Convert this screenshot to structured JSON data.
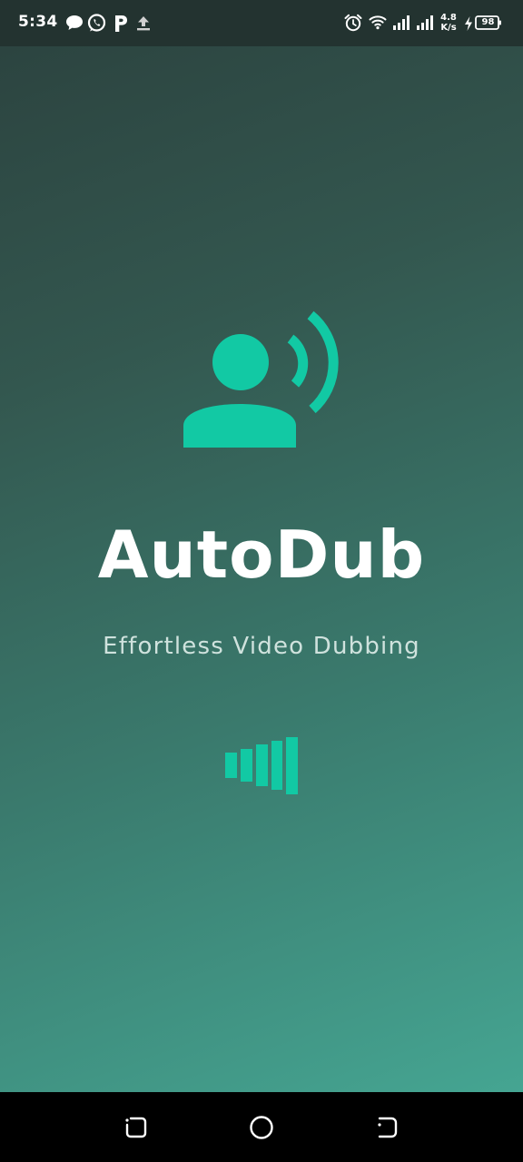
{
  "status_bar": {
    "time": "5:34",
    "net_speed_value": "4.8",
    "net_speed_unit": "K/s",
    "battery_level": "98",
    "notification_icons": [
      "chat-bubble-icon",
      "whatsapp-icon",
      "p-app-icon",
      "upload-icon"
    ],
    "system_icons": [
      "alarm-icon",
      "wifi-icon",
      "signal-icon",
      "signal-icon",
      "charging-icon",
      "battery-icon"
    ]
  },
  "splash": {
    "title": "AutoDub",
    "subtitle": "Effortless Video Dubbing",
    "logo_icon": "person-speaking-icon",
    "loading_icon": "loading-bars-icon",
    "accent_color": "#12c9a4"
  },
  "nav_bar": {
    "buttons": [
      "recent-apps-button",
      "home-button",
      "back-button"
    ]
  }
}
